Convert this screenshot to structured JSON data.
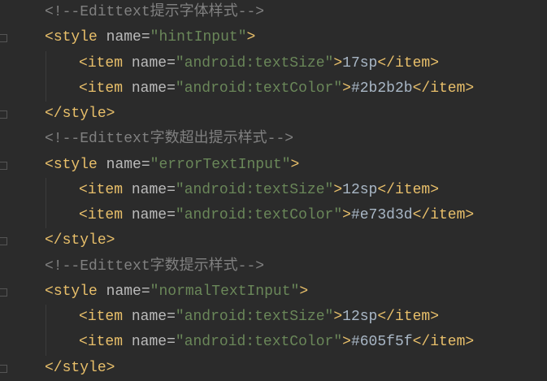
{
  "lines": [
    {
      "type": "comment",
      "open": "<!--",
      "word": "Edittext",
      "rest": "提示字体样式",
      "close": "-->"
    },
    {
      "type": "style_open",
      "tag": "style",
      "attr": "name",
      "value": "hintInput"
    },
    {
      "type": "item",
      "attr": "name",
      "value": "android:textSize",
      "text": "17sp"
    },
    {
      "type": "item",
      "attr": "name",
      "value": "android:textColor",
      "text": "#2b2b2b"
    },
    {
      "type": "style_close",
      "tag": "style"
    },
    {
      "type": "comment",
      "open": "<!--",
      "word": "Edittext",
      "rest": "字数超出提示样式",
      "close": "-->"
    },
    {
      "type": "style_open",
      "tag": "style",
      "attr": "name",
      "value": "errorTextInput"
    },
    {
      "type": "item",
      "attr": "name",
      "value": "android:textSize",
      "text": "12sp"
    },
    {
      "type": "item",
      "attr": "name",
      "value": "android:textColor",
      "text": "#e73d3d"
    },
    {
      "type": "style_close",
      "tag": "style"
    },
    {
      "type": "comment",
      "open": "<!--",
      "word": "Edittext",
      "rest": "字数提示样式",
      "close": "-->"
    },
    {
      "type": "style_open",
      "tag": "style",
      "attr": "name",
      "value": "normalTextInput"
    },
    {
      "type": "item",
      "attr": "name",
      "value": "android:textSize",
      "text": "12sp"
    },
    {
      "type": "item",
      "attr": "name",
      "value": "android:textColor",
      "text": "#605f5f"
    },
    {
      "type": "style_close",
      "tag": "style"
    }
  ],
  "item_tag": "item",
  "colors": {
    "background": "#2b2b2b",
    "tag": "#e8bf6a",
    "attribute": "#bababa",
    "value": "#6a8759",
    "text": "#a9b7c6",
    "comment": "#808080"
  }
}
